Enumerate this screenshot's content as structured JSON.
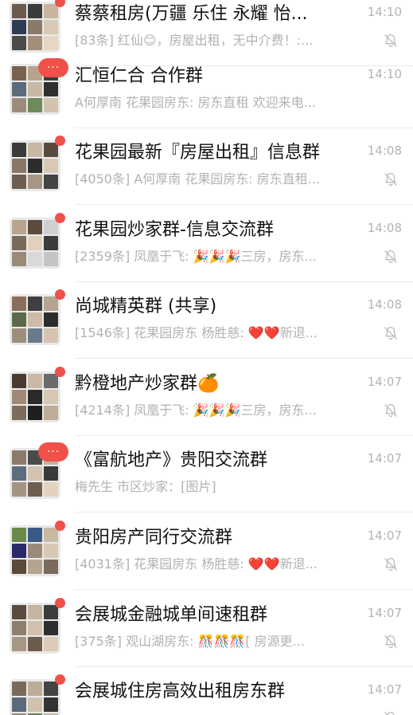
{
  "chats": [
    {
      "title": "蔡蔡租房(万疆 乐住 永耀 怡...",
      "time": "14:10",
      "preview": "[83条] 红仙😊，房屋出租，无中介费！:...",
      "badge": "dot",
      "muted": true,
      "avatar_colors": [
        "#6b5a4e",
        "#3b3b3b",
        "#c9b59d",
        "#2e3b55",
        "#8a7a6a",
        "#d7c9b5",
        "#4a4a4a",
        "#a58d7a",
        "#e6d7c3"
      ]
    },
    {
      "title": "汇恒仁合  合作群",
      "time": "14:10",
      "preview": "A何厚南 花果园房东: 房东直租 欢迎来电...",
      "badge": "pill",
      "badge_text": "···",
      "muted": false,
      "avatar_colors": [
        "#7a6250",
        "#b8a48e",
        "#3c3c3c",
        "#5b6b7a",
        "#c8b8a4",
        "#2f2f2f",
        "#9c8c7a",
        "#6d8a5a",
        "#d2c2ae"
      ]
    },
    {
      "title": "花果园最新『房屋出租』信息群",
      "time": "14:08",
      "preview": "[4050条] A何厚南 花果园房东: 房东直租...",
      "badge": "dot",
      "muted": true,
      "avatar_colors": [
        "#3a3a3a",
        "#c7b7a3",
        "#5a4a3e",
        "#8a7666",
        "#2c2c2c",
        "#d8c8b4",
        "#6e5e52",
        "#a89684",
        "#444444"
      ]
    },
    {
      "title": "花果园炒家群-信息交流群",
      "time": "14:08",
      "preview": "[2359条] 凤凰于飞: 🎉🎉🎉三房，房东...",
      "badge": "dot",
      "muted": true,
      "avatar_colors": [
        "#b9a48e",
        "#5c4c40",
        "#cfcfcf",
        "#7a6a5a",
        "#e0d0bc",
        "#3b3b3b",
        "#9a8a78",
        "#d9d9d9",
        "#c4c4c4"
      ]
    },
    {
      "title": "尚城精英群 (共享)",
      "time": "14:08",
      "preview": "[1546条] 花果园房东 杨胜慈: ❤️❤️新退...",
      "badge": "dot",
      "muted": true,
      "avatar_colors": [
        "#8a6e5a",
        "#3f3f3f",
        "#b4a490",
        "#5a6a4a",
        "#cbbba7",
        "#2d2d2d",
        "#9e8e7c",
        "#6a7a8a",
        "#d4c4b0"
      ]
    },
    {
      "title": "黔橙地产炒家群🍊",
      "time": "14:07",
      "preview": "[4214条] 凤凰于飞: 🎉🎉🎉三房，房东...",
      "badge": "dot",
      "muted": true,
      "avatar_colors": [
        "#4a3a30",
        "#c9b9a5",
        "#6b6b6b",
        "#a08a76",
        "#2a2a2a",
        "#d6c6b2",
        "#7c6c5c",
        "#1f1f1f",
        "#bcac98"
      ]
    },
    {
      "title": "《富航地产》贵阳交流群",
      "time": "14:07",
      "preview": "梅先生 市区炒家：[图片]",
      "badge": "pill",
      "badge_text": "···",
      "muted": false,
      "avatar_colors": [
        "#8c7a6a",
        "#4b4b4b",
        "#c2b29e",
        "#5d6d7d",
        "#d3c3af",
        "#3a3a3a",
        "#a49482",
        "#6e5e4e",
        "#e2d2be"
      ]
    },
    {
      "title": "贵阳房产同行交流群",
      "time": "14:07",
      "preview": "[4031条] 花果园房东 杨胜慈: ❤️❤️新退...",
      "badge": "dot",
      "muted": true,
      "avatar_colors": [
        "#6a8a4a",
        "#3a5a8a",
        "#c8b8a4",
        "#2a2a6a",
        "#9a8a78",
        "#d8c8b4",
        "#5a4a3a",
        "#b4a490",
        "#7a6a5a"
      ]
    },
    {
      "title": "会展城金融城单间速租群",
      "time": "14:07",
      "preview": "[375条] 观山湖房东:  🎊🎊🎊[ 房源更...",
      "badge": "dot",
      "muted": true,
      "avatar_colors": [
        "#5a4a40",
        "#c4b4a0",
        "#3c3c3c",
        "#8e7e6e",
        "#d0c0ac",
        "#2e2e2e",
        "#a69684",
        "#6c5c4c",
        "#dccbb7"
      ]
    },
    {
      "title": "会展城住房高效出租房东群",
      "time": "14:07",
      "preview": "",
      "badge": "dot",
      "muted": true,
      "avatar_colors": [
        "#7a6a5a",
        "#bcac98",
        "#444444",
        "#5a6a7a",
        "#d1c1ad",
        "#333333",
        "#9a8a78",
        "#6a7a5a",
        "#c8b8a4"
      ]
    }
  ]
}
